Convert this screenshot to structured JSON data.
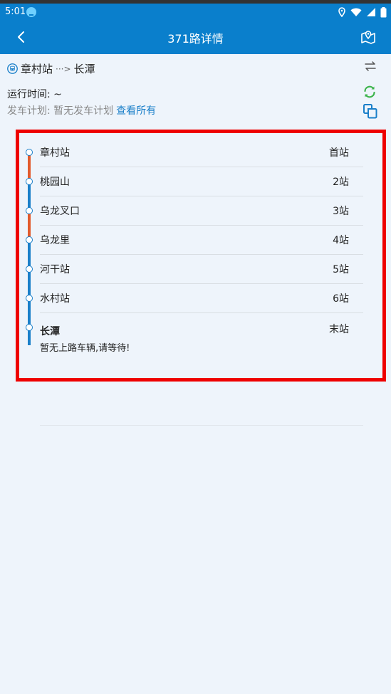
{
  "status_bar": {
    "time": "5:01"
  },
  "app_bar": {
    "title": "371路详情"
  },
  "route": {
    "from": "章村站",
    "arrow": "···>",
    "to": "长潭"
  },
  "info": {
    "run_time": "运行时间: ~",
    "schedule_label": "发车计划: 暂无发车计划",
    "schedule_link": "查看所有"
  },
  "stations": [
    {
      "name": "章村站",
      "index": "首站"
    },
    {
      "name": "桃园山",
      "index": "2站"
    },
    {
      "name": "乌龙叉口",
      "index": "3站"
    },
    {
      "name": "乌龙里",
      "index": "4站"
    },
    {
      "name": "河干站",
      "index": "5站"
    },
    {
      "name": "水村站",
      "index": "6站"
    },
    {
      "name": "长潭",
      "index": "末站",
      "note": "暂无上路车辆,请等待!"
    }
  ],
  "colors": {
    "primary": "#0a7fcc",
    "line_blue": "#1a7fc9",
    "line_red": "#e25a2c",
    "refresh_green": "#3bb34a",
    "highlight": "#ee0000"
  },
  "icons": {
    "back": "chevron-left-icon",
    "map": "map-pin-icon",
    "bus": "bus-icon",
    "swap": "swap-icon",
    "refresh": "refresh-icon",
    "copy": "copy-icon"
  }
}
